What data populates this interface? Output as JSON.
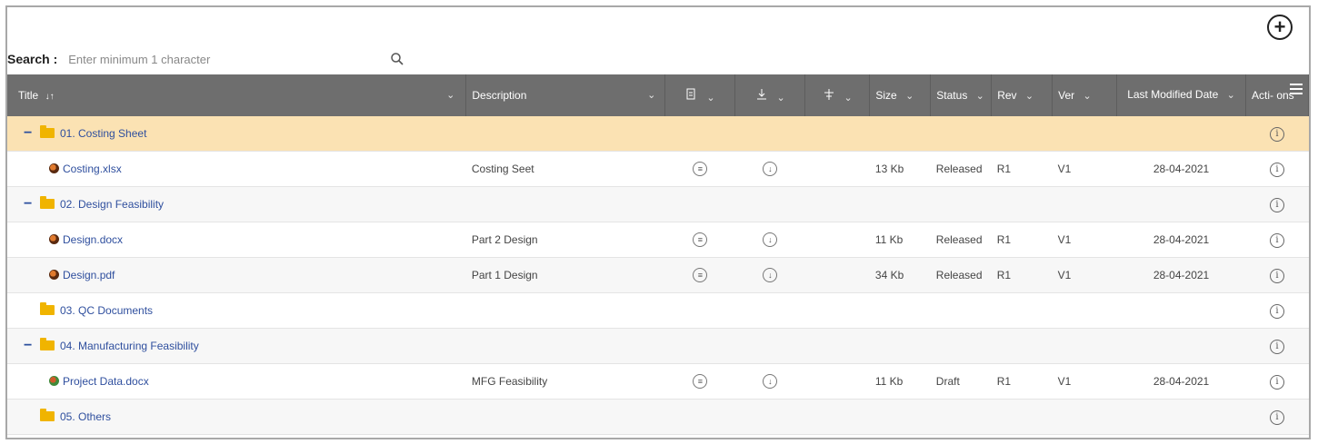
{
  "toolbar": {
    "add_symbol": "+"
  },
  "search": {
    "label": "Search :",
    "placeholder": "Enter minimum 1 character"
  },
  "columns": {
    "title": "Title",
    "description": "Description",
    "size": "Size",
    "status": "Status",
    "rev": "Rev",
    "ver": "Ver",
    "last_modified": "Last Modified Date",
    "actions": "Acti- ons"
  },
  "rows": [
    {
      "kind": "folder",
      "expanded": true,
      "name": "01. Costing Sheet",
      "selected": true
    },
    {
      "kind": "file",
      "name": "Costing.xlsx",
      "description": "Costing Seet",
      "size": "13 Kb",
      "status": "Released",
      "rev": "R1",
      "ver": "V1",
      "date": "28-04-2021"
    },
    {
      "kind": "folder",
      "expanded": true,
      "name": "02. Design Feasibility"
    },
    {
      "kind": "file",
      "name": "Design.docx",
      "description": "Part 2 Design",
      "size": "11 Kb",
      "status": "Released",
      "rev": "R1",
      "ver": "V1",
      "date": "28-04-2021"
    },
    {
      "kind": "file",
      "name": "Design.pdf",
      "description": "Part 1 Design",
      "size": "34 Kb",
      "status": "Released",
      "rev": "R1",
      "ver": "V1",
      "date": "28-04-2021"
    },
    {
      "kind": "folder",
      "expanded": false,
      "name": "03. QC Documents"
    },
    {
      "kind": "folder",
      "expanded": true,
      "name": "04. Manufacturing Feasibility"
    },
    {
      "kind": "file",
      "name": "Project Data.docx",
      "description": "MFG Feasibility",
      "size": "11 Kb",
      "status": "Draft",
      "rev": "R1",
      "ver": "V1",
      "date": "28-04-2021"
    },
    {
      "kind": "folder",
      "expanded": false,
      "name": "05. Others"
    }
  ],
  "icons": {
    "add": "plus-circle-icon",
    "search": "magnifier-icon",
    "folder": "folder-icon",
    "file": "document-icon",
    "info": "info-icon",
    "view": "view-icon",
    "download": "download-icon"
  },
  "colors": {
    "header_bg": "#6e6e6e",
    "selected_row": "#fbe2b3",
    "link": "#2f4f9e",
    "folder": "#f0b400"
  }
}
